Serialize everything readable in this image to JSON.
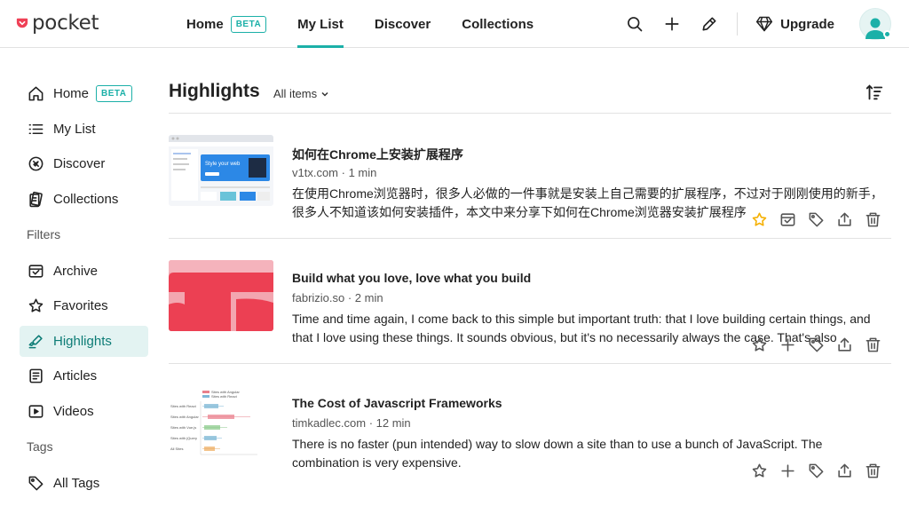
{
  "header": {
    "logo_text": "pocket",
    "nav": [
      {
        "label": "Home",
        "badge": "BETA"
      },
      {
        "label": "My List"
      },
      {
        "label": "Discover"
      },
      {
        "label": "Collections"
      }
    ],
    "upgrade_label": "Upgrade",
    "icons": [
      "search-icon",
      "plus-icon",
      "pencil-icon",
      "diamond-icon",
      "avatar"
    ]
  },
  "sidebar": {
    "items": [
      {
        "label": "Home",
        "badge": "BETA",
        "icon": "home-icon"
      },
      {
        "label": "My List",
        "icon": "list-icon"
      },
      {
        "label": "Discover",
        "icon": "compass-icon"
      },
      {
        "label": "Collections",
        "icon": "collections-icon"
      }
    ],
    "filters_heading": "Filters",
    "filters": [
      {
        "label": "Archive",
        "icon": "archive-icon"
      },
      {
        "label": "Favorites",
        "icon": "star-icon"
      },
      {
        "label": "Highlights",
        "icon": "highlighter-icon",
        "active": true
      },
      {
        "label": "Articles",
        "icon": "article-icon"
      },
      {
        "label": "Videos",
        "icon": "video-icon"
      }
    ],
    "tags_heading": "Tags",
    "tags": [
      {
        "label": "All Tags",
        "icon": "tag-icon"
      }
    ]
  },
  "main": {
    "title": "Highlights",
    "filter_label": "All items",
    "items": [
      {
        "title": "如何在Chrome上安装扩展程序",
        "meta": "v1tx.com · 1 min",
        "excerpt": "在使用Chrome浏览器时，很多人必做的一件事就是安装上自己需要的扩展程序，不过对于刚刚使用的新手，很多人不知道该如何安装插件，本文中来分享下如何在Chrome浏览器安装扩展程序",
        "favorited": true,
        "thumb_text": "Style your web"
      },
      {
        "title": "Build what you love, love what you build",
        "meta": "fabrizio.so · 2 min",
        "excerpt": "Time and time again, I come back to this simple but important truth: that I love building certain things, and that I love using these things. It sounds obvious, but it's no necessarily always the case. That's also",
        "favorited": false
      },
      {
        "title": "The Cost of Javascript Frameworks",
        "meta": "timkadlec.com · 12 min",
        "excerpt": "There is no faster (pun intended) way to slow down a site than to use a bunch of JavaScript. The combination is very expensive.",
        "favorited": false,
        "thumb_legend": [
          "Sites with Angular",
          "Sites with React"
        ],
        "thumb_rows": [
          "Sites with React",
          "Sites with Angular",
          "Sites with Vue.js",
          "Sites with jQuery",
          "All Sites"
        ]
      }
    ]
  },
  "colors": {
    "accent": "#1cb0a8",
    "brand_red": "#ef4056",
    "star_gold": "#f5b000",
    "active_bg": "#e3f3f2"
  }
}
